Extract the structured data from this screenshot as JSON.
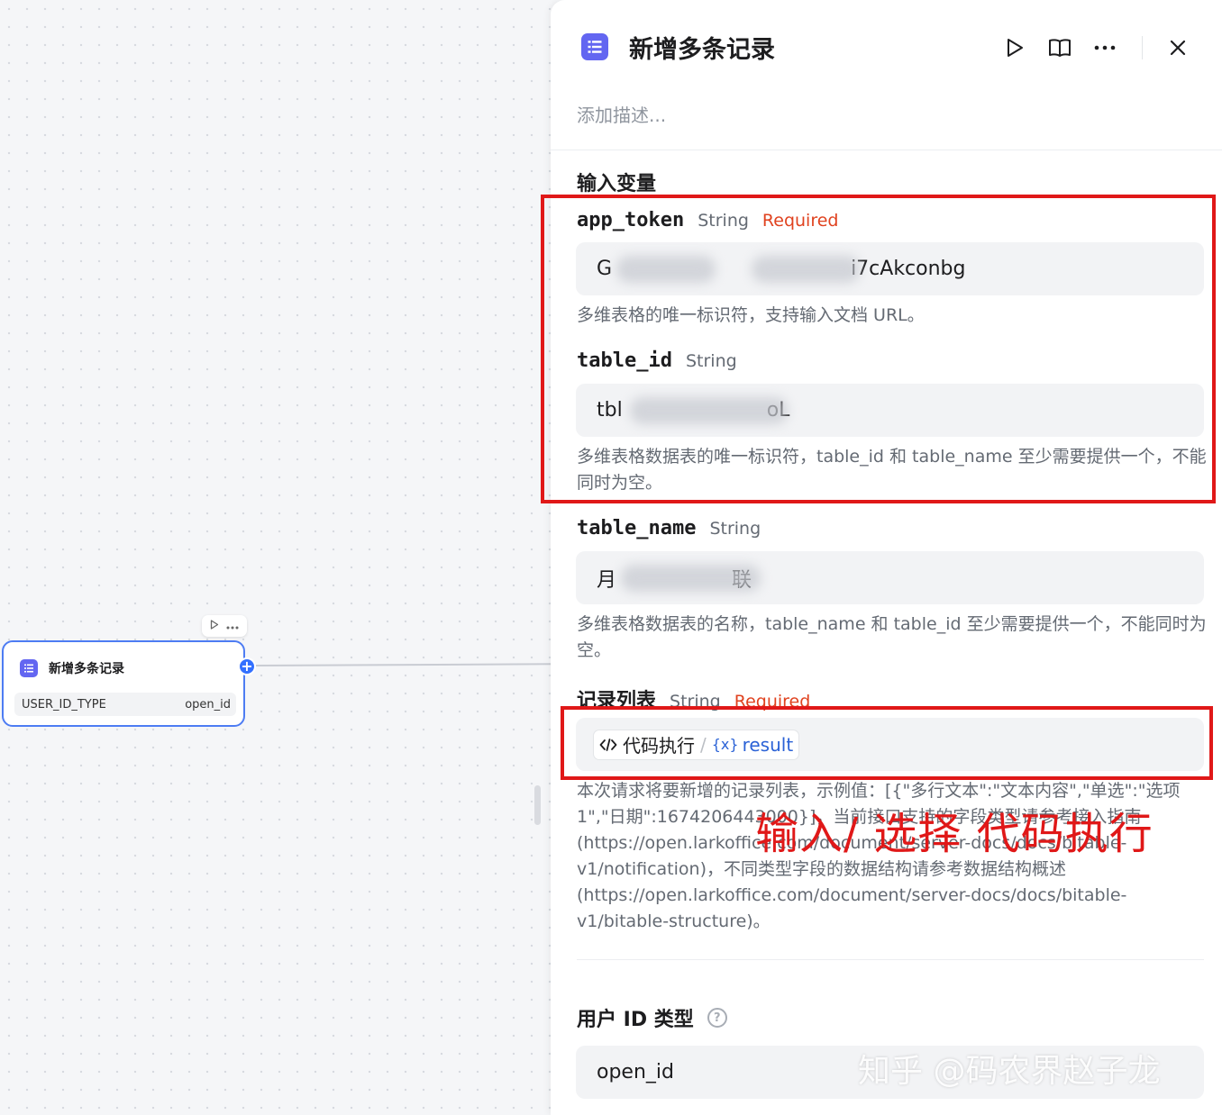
{
  "canvas": {
    "node": {
      "title": "新增多条记录",
      "param_name": "USER_ID_TYPE",
      "param_value": "open_id"
    }
  },
  "panel": {
    "title": "新增多条记录",
    "description_placeholder": "添加描述...",
    "section_title": "输入变量",
    "fields": {
      "app_token": {
        "name": "app_token",
        "type": "String",
        "required": "Required",
        "value_start": "G",
        "value_end": "i7cAkconbg",
        "hint": "多维表格的唯一标识符，支持输入文档 URL。"
      },
      "table_id": {
        "name": "table_id",
        "type": "String",
        "value_start": "tbl",
        "value_end": "oL",
        "hint": "多维表格数据表的唯一标识符，table_id 和 table_name 至少需要提供一个，不能同时为空。"
      },
      "table_name": {
        "name": "table_name",
        "type": "String",
        "value_start": "月",
        "value_end": "联",
        "hint": "多维表格数据表的名称，table_name 和 table_id 至少需要提供一个，不能同时为空。"
      },
      "records": {
        "name": "记录列表",
        "type": "String",
        "required": "Required",
        "ref_node": "代码执行",
        "ref_separator": "/",
        "ref_var_prefix": "{x}",
        "ref_var": "result",
        "hint": "本次请求将要新增的记录列表，示例值：[{\"多行文本\":\"文本内容\",\"单选\":\"选项 1\",\"日期\":1674206443000}]，当前接口支持的字段类型请参考接入指南(https://open.larkoffice.com/document/server-docs/docs/bitable-v1/notification)，不同类型字段的数据结构请参考数据结构概述(https://open.larkoffice.com/document/server-docs/docs/bitable-v1/bitable-structure)。"
      },
      "user_id_type": {
        "name": "用户 ID 类型",
        "help_icon": "?",
        "value": "open_id"
      }
    }
  },
  "annotation": {
    "text": "输入/ 选择 代码执行",
    "color": "#e01818"
  },
  "watermark": "知乎 @码农界赵子龙",
  "colors": {
    "accent": "#3370ff",
    "node_icon": "#6366f1",
    "required": "#e0421f",
    "variable": "#2b62d6"
  }
}
